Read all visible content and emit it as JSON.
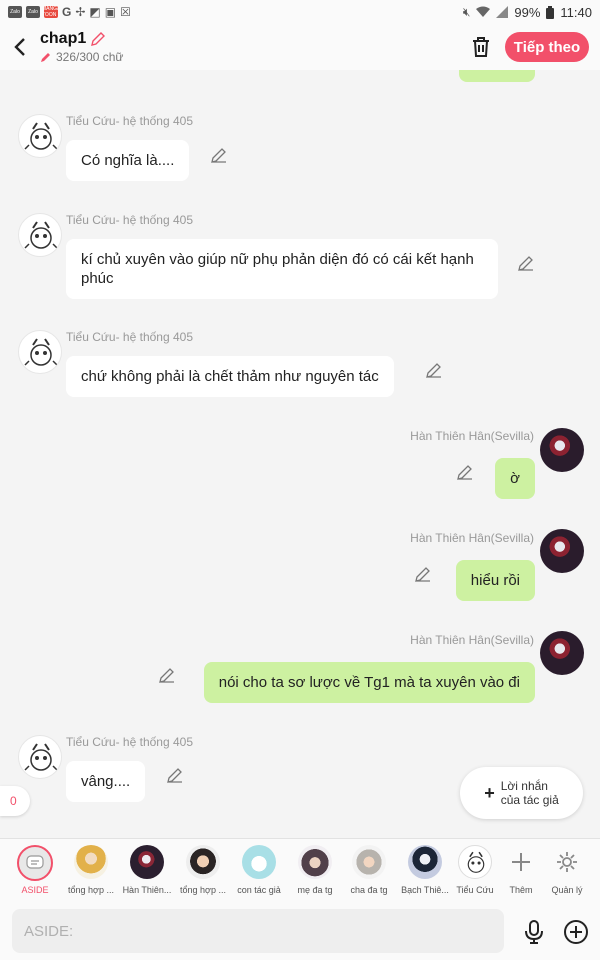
{
  "status_bar": {
    "apps": [
      "Zalo",
      "Zalo",
      "MANGA TOON"
    ],
    "battery": "99%",
    "time": "11:40"
  },
  "header": {
    "title": "chap1",
    "word_count": "326/300 chữ",
    "follow_label": "Tiếp theo",
    "accent_color": "#f2506a"
  },
  "messages": [
    {
      "side": "left",
      "sender": "Tiểu Cứu- hệ thống 405",
      "text": "Có nghĩa là...."
    },
    {
      "side": "left",
      "sender": "Tiểu Cứu- hệ thống 405",
      "text": "kí chủ xuyên vào giúp nữ phụ phản diện đó có cái kết hạnh phúc"
    },
    {
      "side": "left",
      "sender": "Tiểu Cứu- hệ thống 405",
      "text": "chứ không phải là chết thảm như nguyên tác"
    },
    {
      "side": "right",
      "sender": "Hàn Thiên Hân(Sevilla)",
      "text": "ờ"
    },
    {
      "side": "right",
      "sender": "Hàn Thiên Hân(Sevilla)",
      "text": "hiểu rồi"
    },
    {
      "side": "right",
      "sender": "Hàn Thiên Hân(Sevilla)",
      "text": "nói cho ta sơ lược về Tg1 mà ta xuyên vào đi"
    },
    {
      "side": "left",
      "sender": "Tiểu Cứu- hệ thống 405",
      "text": "vâng...."
    }
  ],
  "comment_count": "0",
  "author_note": {
    "line1": "Lời nhắn",
    "line2": "của tác giả"
  },
  "characters": [
    {
      "label": "ASIDE"
    },
    {
      "label": "tổng hợp ..."
    },
    {
      "label": "Hàn Thiên..."
    },
    {
      "label": "tổng hợp ..."
    },
    {
      "label": "con tác giả"
    },
    {
      "label": "mẹ đa tg"
    },
    {
      "label": "cha đa tg"
    },
    {
      "label": "Bạch Thiê..."
    },
    {
      "label": "Tiểu Cứu"
    }
  ],
  "tools": {
    "add_label": "Thêm",
    "manage_label": "Quản lý"
  },
  "input": {
    "placeholder": "ASIDE:"
  }
}
